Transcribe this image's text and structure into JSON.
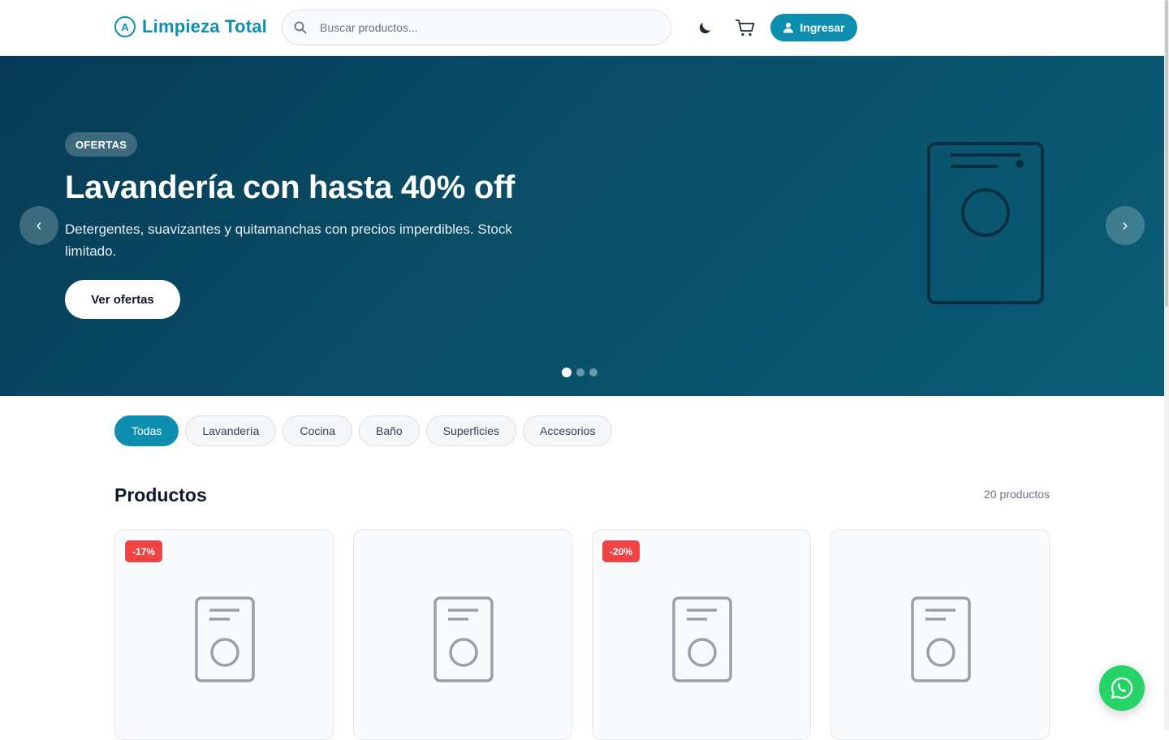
{
  "header": {
    "logo_text": "Limpieza Total",
    "logo_icon": "A",
    "search_placeholder": "Buscar productos...",
    "login_label": "Ingresar"
  },
  "hero": {
    "badge": "OFERTAS",
    "title": "Lavandería con hasta 40% off",
    "subtitle": "Detergentes, suavizantes y quitamanchas con precios imperdibles. Stock limitado.",
    "cta": "Ver ofertas",
    "prev": "‹",
    "next": "›",
    "slides": 3,
    "active_slide": 1
  },
  "categories": [
    {
      "label": "Todas",
      "active": true
    },
    {
      "label": "Lavandería",
      "active": false
    },
    {
      "label": "Cocina",
      "active": false
    },
    {
      "label": "Baño",
      "active": false
    },
    {
      "label": "Superficies",
      "active": false
    },
    {
      "label": "Accesorios",
      "active": false
    }
  ],
  "products": {
    "title": "Productos",
    "count": "20 productos",
    "cards": [
      {
        "discount": "-17%"
      },
      {
        "discount": ""
      },
      {
        "discount": "-20%"
      },
      {
        "discount": ""
      }
    ]
  },
  "colors": {
    "brand": "#0e8fb0",
    "hero_bg": "#0a5068",
    "discount": "#ef4444",
    "whatsapp": "#25d366"
  }
}
